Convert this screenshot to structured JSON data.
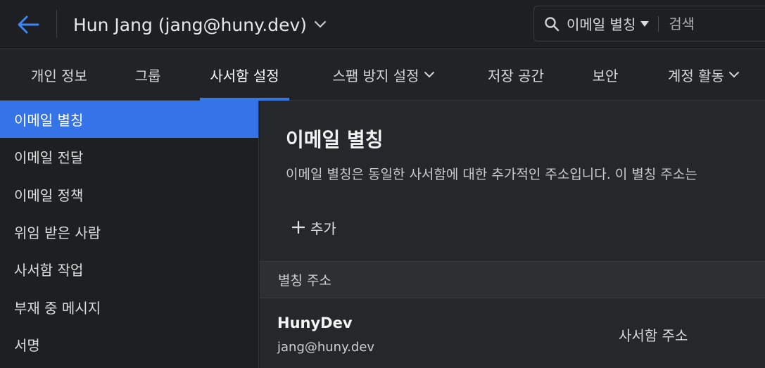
{
  "header": {
    "account_label": "Hun Jang (jang@huny.dev)",
    "search": {
      "scope": "이메일 별칭",
      "placeholder": "검색"
    }
  },
  "tabs": [
    {
      "label": "개인 정보"
    },
    {
      "label": "그룹"
    },
    {
      "label": "사서함 설정",
      "active": true
    },
    {
      "label": "스팸 방지 설정"
    },
    {
      "label": "저장 공간"
    },
    {
      "label": "보안"
    },
    {
      "label": "계정 활동"
    }
  ],
  "sidebar": {
    "items": [
      {
        "label": "이메일 별칭",
        "active": true
      },
      {
        "label": "이메일 전달"
      },
      {
        "label": "이메일 정책"
      },
      {
        "label": "위임 받은 사람"
      },
      {
        "label": "사서함 작업"
      },
      {
        "label": "부재 중 메시지"
      },
      {
        "label": "서명"
      }
    ]
  },
  "main": {
    "title": "이메일 별칭",
    "description": "이메일 별칭은 동일한 사서함에 대한 추가적인 주소입니다. 이 별칭 주소는",
    "add_label": "추가",
    "table": {
      "header": "별칭 주소",
      "rows": [
        {
          "name": "HunyDev",
          "email": "jang@huny.dev",
          "type": "사서함 주소"
        }
      ]
    }
  },
  "colors": {
    "accent": "#3573e8",
    "background": "#1e1f22",
    "panel": "#26272b"
  }
}
